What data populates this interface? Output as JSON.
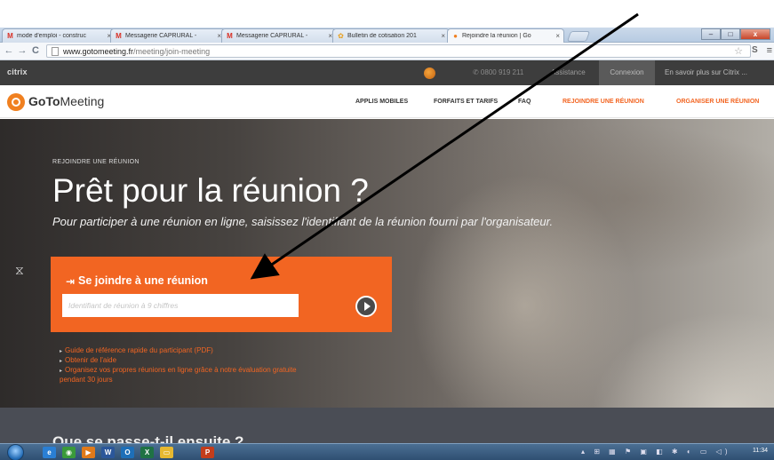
{
  "browser": {
    "tabs": [
      {
        "label": "mode d'emploi - construc",
        "icon": "gmail-icon",
        "favicon_glyph": "M",
        "favicon_color": "#d93025"
      },
      {
        "label": "Messagerie CAPRURAL - ",
        "icon": "gmail-icon",
        "favicon_glyph": "M",
        "favicon_color": "#d93025"
      },
      {
        "label": "Messagerie CAPRURAL - ",
        "icon": "gmail-icon",
        "favicon_glyph": "M",
        "favicon_color": "#d93025"
      },
      {
        "label": "Bulletin de cotisation 201",
        "icon": "tulip-icon",
        "favicon_glyph": "✿",
        "favicon_color": "#e8a020"
      },
      {
        "label": "Rejoindre la réunion | Go",
        "icon": "gotomeeting-icon",
        "favicon_glyph": "●",
        "favicon_color": "#f08020"
      }
    ],
    "tab_close_glyph": "×",
    "url_host": "www.gotomeeting.fr",
    "url_path": "/meeting/join-meeting",
    "window_buttons": {
      "minimize": "–",
      "maximize": "□",
      "close": "x"
    }
  },
  "citrix_bar": {
    "logo": "citrix",
    "phone": "✆ 0800 919 211",
    "assistance": "Assistance",
    "connexion": "Connexion",
    "learn_more": "En savoir plus sur Citrix  ...",
    "accent": "#3d3d3d"
  },
  "goto_nav": {
    "logo_bold": "GoTo",
    "logo_rest": "Meeting",
    "links": [
      "APPLIS MOBILES",
      "FORFAITS ET TARIFS",
      "FAQ",
      "REJOINDRE UNE RÉUNION",
      "ORGANISER UNE RÉUNION"
    ],
    "accent": "#f26522"
  },
  "hero": {
    "kicker": "REJOINDRE UNE RÉUNION",
    "title": "Prêt pour la réunion ?",
    "subtitle": "Pour participer à une réunion en ligne, saisissez l'identifiant de la réunion fourni par l'organisateur."
  },
  "join": {
    "title": "Se joindre à une réunion",
    "placeholder": "Identifiant de réunion à 9 chiffres",
    "panel_color": "#f26522"
  },
  "links": [
    "Guide de référence rapide du participant (PDF)",
    "Obtenir de l'aide",
    "Organisez vos propres réunions en ligne grâce à notre évaluation gratuite",
    "pendant 30 jours"
  ],
  "next_section": {
    "title": "Que se passe-t-il ensuite ?"
  },
  "taskbar": {
    "clock": "11:34",
    "apps": [
      {
        "icon": "ie-icon",
        "color": "#2a7fd4"
      },
      {
        "icon": "chrome-icon",
        "color": "#3a9a3a"
      },
      {
        "icon": "media-player-icon",
        "color": "#e07a1a"
      },
      {
        "icon": "word-icon",
        "color": "#2b579a"
      },
      {
        "icon": "outlook-icon",
        "color": "#1e6fb8"
      },
      {
        "icon": "excel-icon",
        "color": "#1f7244"
      },
      {
        "icon": "folder-icon",
        "color": "#e6b830"
      },
      {
        "icon": "powerpoint-icon",
        "color": "#c33d1c"
      }
    ]
  }
}
